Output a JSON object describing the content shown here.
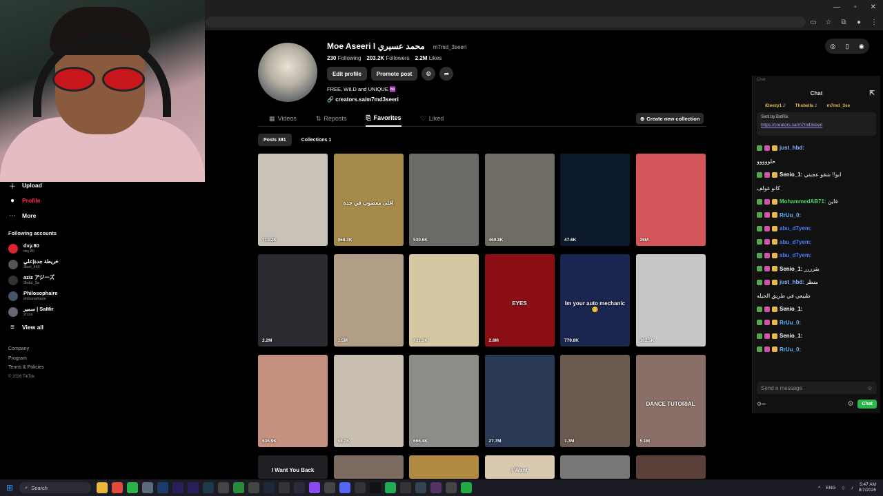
{
  "browser": {
    "window_controls": [
      "—",
      "▫",
      "✕"
    ]
  },
  "profile": {
    "display_name": "Moe Aseeri I محمد عسيري",
    "handle": "m7md_3seeri",
    "following_count": "230",
    "following_label": "Following",
    "followers_count": "203.2K",
    "followers_label": "Followers",
    "likes_count": "2.2M",
    "likes_label": "Likes",
    "edit_label": "Edit profile",
    "promote_label": "Promote post",
    "bio": "FREE, WILD and UNIQUE ♾️",
    "link": "creators.sa/m7md3seeri"
  },
  "tabs": [
    {
      "label": "Videos"
    },
    {
      "label": "Reposts"
    },
    {
      "label": "Favorites"
    },
    {
      "label": "Liked"
    }
  ],
  "create_collection": "Create new collection",
  "subtabs": {
    "posts": "Posts 381",
    "collections": "Collections 1"
  },
  "sidebar": {
    "upload": "Upload",
    "profile": "Profile",
    "more": "More",
    "following_heading": "Following accounts",
    "accounts": [
      {
        "name": "dxy.80",
        "handle": "dxy.80"
      },
      {
        "name": "خريطة جدة|علي",
        "handle": "3laei_460"
      },
      {
        "name": "aziz アジーズ",
        "handle": "3bdul_3a"
      },
      {
        "name": "Philosophaire",
        "handle": "philosophaire"
      },
      {
        "name": "سمير | SaMir",
        "handle": "2rcos"
      }
    ],
    "view_all": "View all",
    "footer": [
      "Company",
      "Program",
      "Terms & Policies"
    ],
    "copyright": "© 2026 TikTok"
  },
  "videos": [
    {
      "count": "719.2K",
      "caption": "",
      "color": "#c9c2b8"
    },
    {
      "count": "968.3K",
      "caption": "اغلى معصوب في جدة",
      "color": "#a58a4a"
    },
    {
      "count": "530.6K",
      "caption": "",
      "color": "#6b6a66"
    },
    {
      "count": "469.8K",
      "caption": "",
      "color": "#6f6c64"
    },
    {
      "count": "47.6K",
      "caption": "",
      "color": "#0c1a2c"
    },
    {
      "count": "26M",
      "caption": "",
      "color": "#d5565a"
    },
    {
      "count": "2.2M",
      "caption": "",
      "color": "#2a2a30"
    },
    {
      "count": "1.5M",
      "caption": "",
      "color": "#b29d86"
    },
    {
      "count": "431.3K",
      "caption": "",
      "color": "#d4c7a2"
    },
    {
      "count": "2.8M",
      "caption": "EYES",
      "color": "#8a0e14"
    },
    {
      "count": "779.8K",
      "caption": "Im your auto mechanic 😋",
      "color": "#1a2550"
    },
    {
      "count": "102.5K",
      "caption": "",
      "color": "#c6c8c5"
    },
    {
      "count": "636.9K",
      "caption": "",
      "color": "#c49080"
    },
    {
      "count": "68.7K",
      "caption": "",
      "color": "#c8bfb0"
    },
    {
      "count": "666.4K",
      "caption": "",
      "color": "#8c8c88"
    },
    {
      "count": "27.7M",
      "caption": "",
      "color": "#2a3a55"
    },
    {
      "count": "1.3M",
      "caption": "",
      "color": "#6a5a50"
    },
    {
      "count": "5.1M",
      "caption": "DANCE TUTORIAL",
      "color": "#8a6e68"
    },
    {
      "count": "",
      "caption": "I Want You Back",
      "color": "#1f1f24"
    },
    {
      "count": "",
      "caption": "",
      "color": "#7a6a60"
    },
    {
      "count": "",
      "caption": "",
      "color": "#b08a40"
    },
    {
      "count": "",
      "caption": "I Want",
      "color": "#d8c9b0"
    },
    {
      "count": "",
      "caption": "",
      "color": "#777"
    },
    {
      "count": "",
      "caption": "",
      "color": "#5a4038"
    }
  ],
  "chat": {
    "header_small": "Chat",
    "title": "Chat",
    "gifters": [
      {
        "name": "iDeezy1",
        "n": "2"
      },
      {
        "name": "Thsbella",
        "n": "1"
      },
      {
        "name": "m7md_3se",
        "n": ""
      }
    ],
    "pinned_sender": "Sent by BotRix",
    "pinned_link": "https://creators.sa/m7md3seeri",
    "messages": [
      {
        "user": "just_hbd:",
        "text": "",
        "color": "#8ab4ff"
      },
      {
        "user": "",
        "text": "حلووووو",
        "color": "#fff"
      },
      {
        "user": "Senio_1:",
        "text": "ابو!! شقو عجبني",
        "color": "#fff"
      },
      {
        "user": "",
        "text": "كانو غولف",
        "color": "#fff"
      },
      {
        "user": "MohammedAB71:",
        "text": "فاين",
        "color": "#4ed66b"
      },
      {
        "user": "RrUu_0:",
        "text": "",
        "color": "#5cb8ff"
      },
      {
        "user": "abu_d7yem:",
        "text": "",
        "color": "#4a7dff"
      },
      {
        "user": "abu_d7yem:",
        "text": "",
        "color": "#4a7dff"
      },
      {
        "user": "abu_d7yem:",
        "text": "",
        "color": "#4a7dff"
      },
      {
        "user": "Senio_1:",
        "text": "بقرررر",
        "color": "#fff"
      },
      {
        "user": "just_hbd:",
        "text": "منظر",
        "color": "#8ab4ff"
      },
      {
        "user": "",
        "text": "طبيعي في طريق الحيله",
        "color": "#fff"
      },
      {
        "user": "Senio_1:",
        "text": "",
        "color": "#fff"
      },
      {
        "user": "RrUu_0:",
        "text": "",
        "color": "#5cb8ff"
      },
      {
        "user": "Senio_1:",
        "text": "",
        "color": "#fff"
      },
      {
        "user": "",
        "text": "",
        "color": "#fff"
      },
      {
        "user": "RrUu_0:",
        "text": "",
        "color": "#5cb8ff"
      }
    ],
    "input_placeholder": "Send a message",
    "send_label": "Chat"
  },
  "taskbar": {
    "search": "Search",
    "lang": "ENG",
    "time": "5:47 AM",
    "date": "8/7/2026"
  }
}
